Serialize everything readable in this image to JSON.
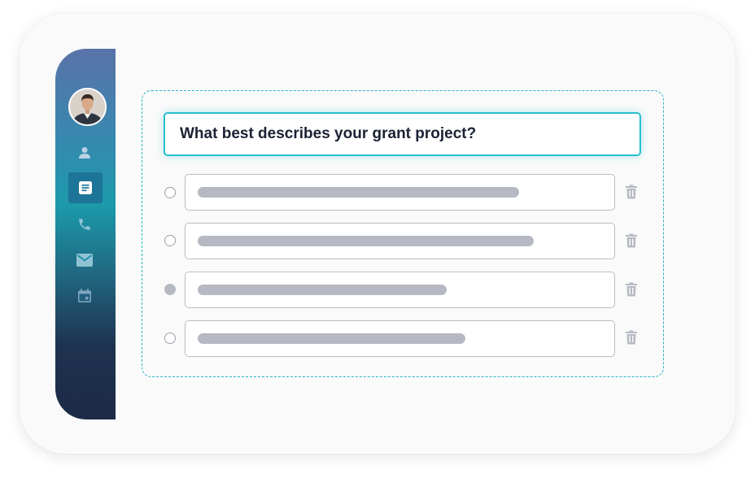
{
  "question": {
    "text": "What best describes your grant project?"
  },
  "sidebar": {
    "items": [
      {
        "icon": "person-icon",
        "active": false
      },
      {
        "icon": "document-icon",
        "active": true
      },
      {
        "icon": "phone-icon",
        "active": false
      },
      {
        "icon": "mail-icon",
        "active": false
      },
      {
        "icon": "calendar-icon",
        "active": false
      }
    ]
  },
  "options": [
    {
      "selected": false,
      "placeholder_fill": 0.77
    },
    {
      "selected": false,
      "placeholder_fill": 0.8
    },
    {
      "selected": true,
      "placeholder_fill": 0.59
    },
    {
      "selected": false,
      "placeholder_fill": 0.64
    }
  ],
  "colors": {
    "accent": "#29bfcc",
    "sidebar_active": "#1c7498",
    "placeholder_bar": "#b6b9c3",
    "text": "#1b2233"
  }
}
